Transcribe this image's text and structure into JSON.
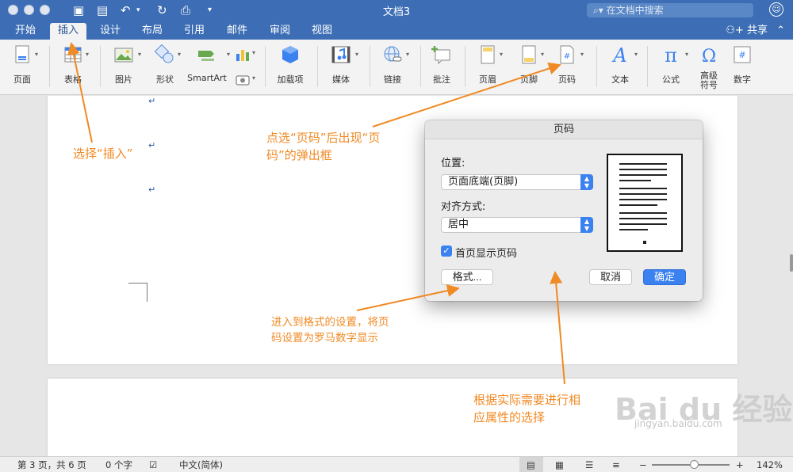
{
  "window": {
    "title": "文档3",
    "search_placeholder": "在文档中搜索"
  },
  "tabs": [
    {
      "label": "开始"
    },
    {
      "label": "插入"
    },
    {
      "label": "设计"
    },
    {
      "label": "布局"
    },
    {
      "label": "引用"
    },
    {
      "label": "邮件"
    },
    {
      "label": "审阅"
    },
    {
      "label": "视图"
    }
  ],
  "active_tab": "插入",
  "share_label": "共享",
  "ribbon": [
    {
      "label": "页面",
      "icon": "page-icon"
    },
    {
      "label": "表格",
      "icon": "table-icon"
    },
    {
      "label": "图片",
      "icon": "picture-icon"
    },
    {
      "label": "形状",
      "icon": "shapes-icon"
    },
    {
      "label": "SmartArt",
      "icon": "smartart-icon"
    },
    {
      "label": "加载项",
      "icon": "addins-icon"
    },
    {
      "label": "媒体",
      "icon": "media-icon"
    },
    {
      "label": "链接",
      "icon": "link-icon"
    },
    {
      "label": "批注",
      "icon": "comment-icon"
    },
    {
      "label": "页眉",
      "icon": "header-icon"
    },
    {
      "label": "页脚",
      "icon": "footer-icon"
    },
    {
      "label": "页码",
      "icon": "page-number-icon"
    },
    {
      "label": "文本",
      "icon": "text-icon"
    },
    {
      "label": "公式",
      "icon": "equation-icon"
    },
    {
      "label": "高级符号",
      "label_line1": "高级",
      "label_line2": "符号",
      "icon": "omega-icon"
    },
    {
      "label": "数字",
      "icon": "number-icon"
    }
  ],
  "dialog": {
    "title": "页码",
    "position_label": "位置:",
    "position_value": "页面底端(页脚)",
    "align_label": "对齐方式:",
    "align_value": "居中",
    "first_page_label": "首页显示页码",
    "first_page_checked": true,
    "format_button": "格式...",
    "cancel_button": "取消",
    "ok_button": "确定"
  },
  "annotations": {
    "select_insert": "选择“插入”",
    "click_page_number_l1": "点选“页码”后出现“页",
    "click_page_number_l2": "码”的弹出框",
    "format_l1": "进入到格式的设置，将页",
    "format_l2": "码设置为罗马数字显示",
    "choose_l1": "根据实际需要进行相",
    "choose_l2": "应属性的选择"
  },
  "status": {
    "page": "第 3 页，共 6 页",
    "words": "0 个字",
    "language": "中文(简体)",
    "zoom": "142%",
    "zoom_minus": "−",
    "zoom_plus": "+"
  },
  "watermark": {
    "brand": "Bai du 经验",
    "url": "jingyan.baidu.com"
  },
  "colors": {
    "titlebar": "#3d6eb5",
    "annotation": "#f08a24",
    "accent": "#3b82f0"
  }
}
